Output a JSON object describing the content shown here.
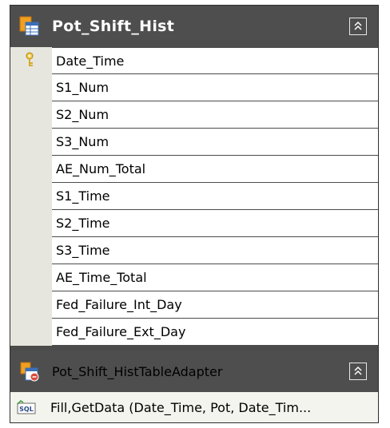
{
  "table": {
    "title": "Pot_Shift_Hist",
    "columns": [
      {
        "name": "Date_Time",
        "is_key": true
      },
      {
        "name": "S1_Num",
        "is_key": false
      },
      {
        "name": "S2_Num",
        "is_key": false
      },
      {
        "name": "S3_Num",
        "is_key": false
      },
      {
        "name": "AE_Num_Total",
        "is_key": false
      },
      {
        "name": "S1_Time",
        "is_key": false
      },
      {
        "name": "S2_Time",
        "is_key": false
      },
      {
        "name": "S3_Time",
        "is_key": false
      },
      {
        "name": "AE_Time_Total",
        "is_key": false
      },
      {
        "name": "Fed_Failure_Int_Day",
        "is_key": false
      },
      {
        "name": "Fed_Failure_Ext_Day",
        "is_key": false
      }
    ]
  },
  "adapter": {
    "title": "Pot_Shift_HistTableAdapter",
    "query": "Fill,GetData (Date_Time, Pot, Date_Tim..."
  },
  "icons": {
    "table": "datatable-icon",
    "key": "primary-key-icon",
    "adapter": "table-adapter-icon",
    "query": "sql-query-icon",
    "collapse": "collapse-chevron-icon"
  }
}
